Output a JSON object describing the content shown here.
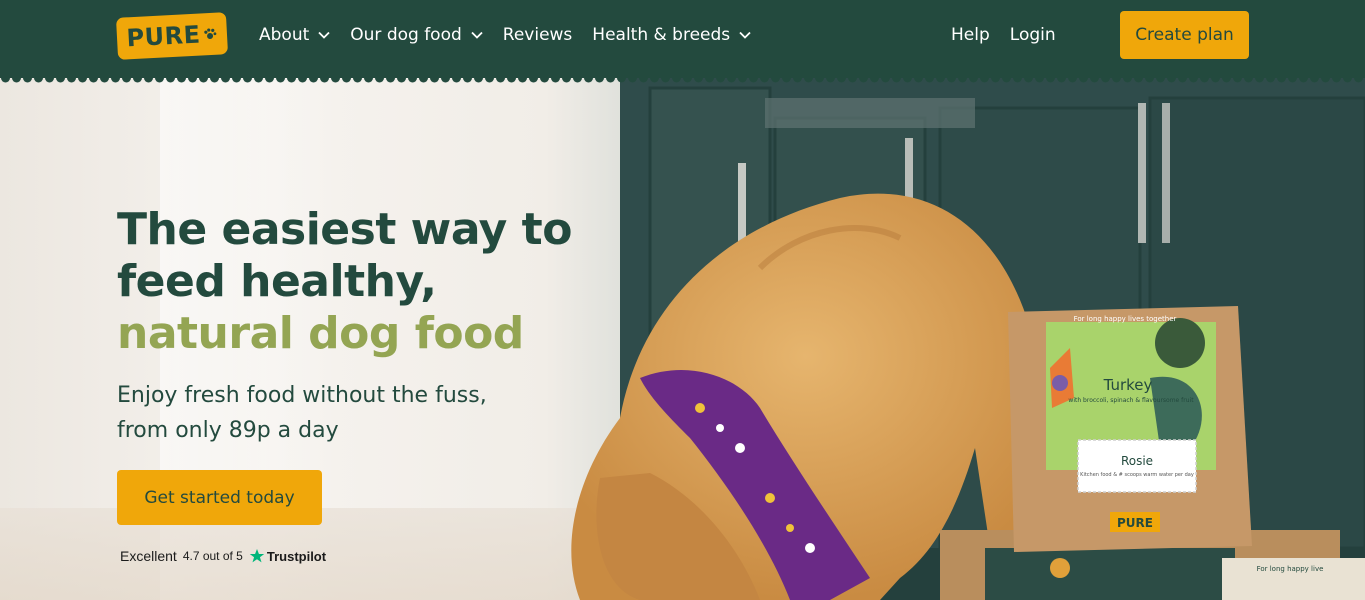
{
  "header": {
    "logo_text": "PURE",
    "nav": [
      {
        "label": "About",
        "has_dropdown": true
      },
      {
        "label": "Our dog food",
        "has_dropdown": true
      },
      {
        "label": "Reviews",
        "has_dropdown": false
      },
      {
        "label": "Health & breeds",
        "has_dropdown": true
      }
    ],
    "right_links": [
      {
        "label": "Help"
      },
      {
        "label": "Login"
      }
    ],
    "cta_label": "Create plan"
  },
  "hero": {
    "title_line1": "The easiest way to",
    "title_line2": "feed healthy,",
    "title_line3": "natural dog food",
    "subtitle_line1": "Enjoy fresh food without the fuss,",
    "subtitle_line2": "from only 89p a day",
    "button_label": "Get started today",
    "trustpilot": {
      "rating_word": "Excellent",
      "score_text": "4.7 out of 5",
      "brand": "Trustpilot"
    },
    "product_bag": {
      "top_text": "For long happy lives together",
      "flavour": "Turkey",
      "flavour_desc": "with broccoli, spinach & flavoursome fruit",
      "pet_name": "Rosie",
      "label_small": "Kitchen food & # scoops warm water per day",
      "brand": "PURE"
    },
    "box_text": "For long happy live"
  },
  "colors": {
    "header_bg": "#234a3e",
    "accent_yellow": "#f0a70a",
    "title_green": "#234a3e",
    "title_accent": "#94a553",
    "trustpilot_green": "#00b67a"
  },
  "icons": {
    "dropdown": "chevron-down-icon",
    "paw": "paw-icon",
    "star": "star-icon"
  }
}
